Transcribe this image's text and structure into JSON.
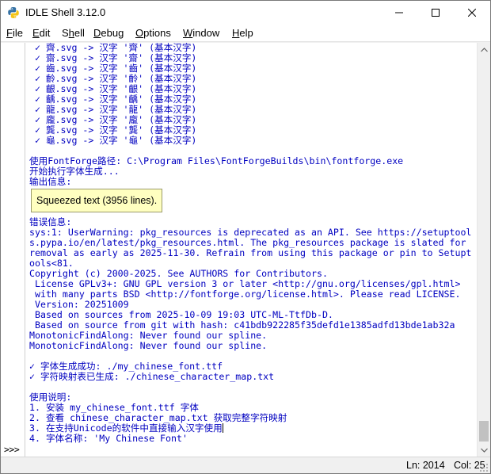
{
  "window": {
    "title": "IDLE Shell 3.12.0"
  },
  "menubar": {
    "items": [
      {
        "underline": "F",
        "rest": "ile"
      },
      {
        "underline": "E",
        "rest": "dit"
      },
      {
        "pre": "S",
        "underline": "h",
        "rest": "ell"
      },
      {
        "underline": "D",
        "rest": "ebug"
      },
      {
        "underline": "O",
        "rest": "ptions"
      },
      {
        "underline": "W",
        "rest": "indow"
      },
      {
        "underline": "H",
        "rest": "elp"
      }
    ]
  },
  "shell": {
    "prompt": ">>>",
    "lines_before": [
      " ✓ 齊.svg -> 汉字 '齊' (基本汉字)",
      " ✓ 齋.svg -> 汉字 '齋' (基本汉字)",
      " ✓ 齒.svg -> 汉字 '齒' (基本汉字)",
      " ✓ 齡.svg -> 汉字 '齡' (基本汉字)",
      " ✓ 齦.svg -> 汉字 '齦' (基本汉字)",
      " ✓ 齲.svg -> 汉字 '齲' (基本汉字)",
      " ✓ 龍.svg -> 汉字 '龍' (基本汉字)",
      " ✓ 龐.svg -> 汉字 '龐' (基本汉字)",
      " ✓ 龔.svg -> 汉字 '龔' (基本汉字)",
      " ✓ 龜.svg -> 汉字 '龜' (基本汉字)",
      "",
      "使用FontForge路径: C:\\Program Files\\FontForgeBuilds\\bin\\fontforge.exe",
      "开始执行字体生成...",
      "输出信息:"
    ],
    "squeezed_label": "Squeezed text (3956 lines).",
    "lines_after": [
      "错误信息:",
      "sys:1: UserWarning: pkg_resources is deprecated as an API. See https://setuptool",
      "s.pypa.io/en/latest/pkg_resources.html. The pkg_resources package is slated for",
      "removal as early as 2025-11-30. Refrain from using this package or pin to Setupt",
      "ools<81.",
      "Copyright (c) 2000-2025. See AUTHORS for Contributors.",
      " License GPLv3+: GNU GPL version 3 or later <http://gnu.org/licenses/gpl.html>",
      " with many parts BSD <http://fontforge.org/license.html>. Please read LICENSE.",
      " Version: 20251009",
      " Based on sources from 2025-10-09 19:03 UTC-ML-TtfDb-D.",
      " Based on source from git with hash: c41bdb922285f35defd1e1385adfd13bde1ab32a",
      "MonotonicFindAlong: Never found our spline.",
      "MonotonicFindAlong: Never found our spline.",
      "",
      "✓ 字体生成成功: ./my_chinese_font.ttf",
      "✓ 字符映射表已生成: ./chinese_character_map.txt",
      "",
      "使用说明:",
      "1. 安装 my_chinese_font.ttf 字体",
      "2. 查看 chinese_character_map.txt 获取完整字符映射",
      "3. 在支持Unicode的软件中直接输入汉字使用",
      "4. 字体名称: 'My Chinese Font'"
    ]
  },
  "statusbar": {
    "line": "Ln: 2014",
    "col": "Col: 25"
  }
}
